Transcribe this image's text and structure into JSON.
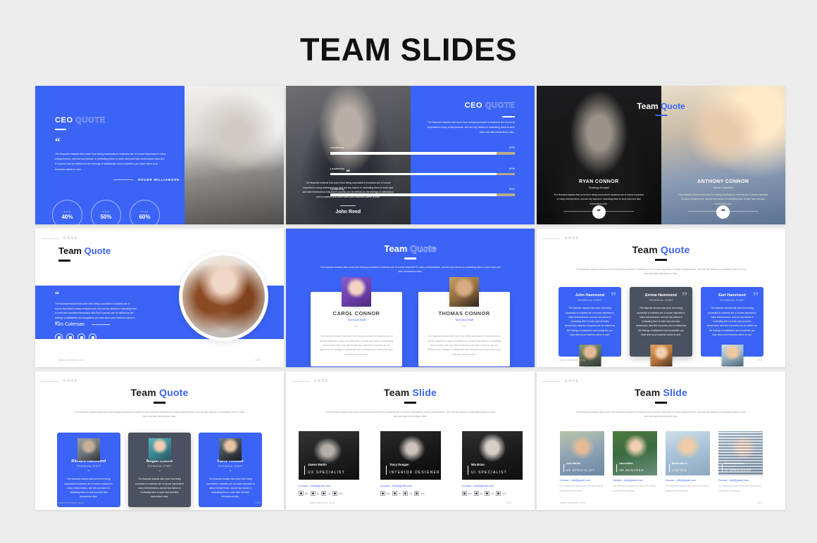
{
  "page": {
    "title": "TEAM SLIDES",
    "accent": "#3b63f6",
    "background": "#ececec"
  },
  "common": {
    "eyebrow": "EASE",
    "website": "www.website.com",
    "quote_glyph": "“",
    "quote_glyph_close": "”",
    "long_quote": "The financial rewards that come from being successful in business are of course important to many entrepreneurs, and are key factors in motivating them to work hard and take tremendous risks.But if success can be defined as the feelings of satisfaction and completion you have when your business career is over.",
    "short_quote": "The financial rewards that come from being successful in business are of course important to many entrepreneurs, and are key factors in motivating them to work hard and take tremendous risks.",
    "sub_line": "The financial rewards that come from being successful in business are of course important to many entrepreneurs, and are key factors in motivating them to work hard and take tremendous risks.",
    "contact": "Contact : info@gmail.com"
  },
  "slides": [
    {
      "id": "ceo-quote-left",
      "heading_solid": "CEO",
      "heading_ghost": "QUOTE",
      "author": "ROGER WILLIAMSON",
      "stats": [
        {
          "label": "TITLE",
          "value": "40%"
        },
        {
          "label": "TITLE",
          "value": "50%"
        },
        {
          "label": "TITLE",
          "value": "60%"
        }
      ]
    },
    {
      "id": "ceo-quote-right",
      "heading_solid": "CEO",
      "heading_ghost": "QUOTE",
      "name": "John Reed",
      "bars": [
        {
          "label": "Leadership",
          "value": "90%",
          "pct": 90
        },
        {
          "label": "Leadership",
          "value": "90%",
          "pct": 90
        },
        {
          "label": "Leadership",
          "value": "90%",
          "pct": 90
        }
      ]
    },
    {
      "id": "team-quote-duo",
      "title_a": "Team",
      "title_b": "Quote",
      "people": [
        {
          "name": "RYAN CONNOR",
          "role": "Strategy Analyst"
        },
        {
          "name": "ANTHONY CONNOR",
          "role": "Senior Statistics"
        }
      ]
    },
    {
      "id": "team-quote-portrait",
      "title_a": "Team",
      "title_b": "Quote",
      "name": "Kim Coleman",
      "socials": [
        "instagram-icon",
        "facebook-icon",
        "twitter-icon",
        "linkedin-icon"
      ],
      "page_number": "185"
    },
    {
      "id": "team-quote-cards-blue",
      "title_a": "Team",
      "title_b": "Quote",
      "cards": [
        {
          "name": "CAROL CONNOR",
          "role": "Technical Staff"
        },
        {
          "name": "THOMAS CONNOR",
          "role": "Technical Staff"
        }
      ]
    },
    {
      "id": "team-quote-three-cards",
      "title_a": "Team",
      "title_b": "Quote",
      "page_number": "199",
      "cards": [
        {
          "name": "John Hammond",
          "role": "TECHNICAL STAFF",
          "theme": "blue"
        },
        {
          "name": "Emma Hammond",
          "role": "TECHNICAL STAFF",
          "theme": "dark"
        },
        {
          "name": "Earl Hammond",
          "role": "TECHNICAL STAFF",
          "theme": "blue"
        }
      ]
    },
    {
      "id": "team-quote-avatar-cards",
      "title_a": "Team",
      "title_b": "Quote",
      "page_number": "190",
      "cards": [
        {
          "name": "Richard Hammond",
          "role": "TECHNICAL STAFF",
          "theme": "blue"
        },
        {
          "name": "Megan Collins",
          "role": "TECHNICAL STAFF",
          "theme": "dark"
        },
        {
          "name": "Harry Thomas",
          "role": "TECHNICAL STAFF",
          "theme": "blue"
        }
      ]
    },
    {
      "id": "team-slide-bw",
      "title_a": "Team",
      "title_b": "Slide",
      "page_number": "199",
      "cards": [
        {
          "name": "James Martin",
          "role": "UX SPECIALIST",
          "chips": [
            {
              "icon": "instagram-icon",
              "count": "50k"
            },
            {
              "icon": "twitter-icon",
              "count": "5k"
            },
            {
              "icon": "youtube-icon",
              "count": "1M"
            },
            {
              "icon": "facebook-icon",
              "count": "50k"
            }
          ]
        },
        {
          "name": "Tracy Dougan",
          "role": "INTERIOR DESIGNER",
          "chips": [
            {
              "icon": "instagram-icon",
              "count": "50k"
            },
            {
              "icon": "twitter-icon",
              "count": "5k"
            },
            {
              "icon": "youtube-icon",
              "count": "1M"
            },
            {
              "icon": "facebook-icon",
              "count": "50k"
            }
          ]
        },
        {
          "name": "Mia Brian",
          "role": "UI SPECIALIST",
          "chips": [
            {
              "icon": "instagram-icon",
              "count": "50k"
            },
            {
              "icon": "twitter-icon",
              "count": "5k"
            },
            {
              "icon": "youtube-icon",
              "count": "1M"
            },
            {
              "icon": "facebook-icon",
              "count": "50k"
            }
          ]
        }
      ]
    },
    {
      "id": "team-slide-color",
      "title_a": "Team",
      "title_b": "Slide",
      "page_number": "230",
      "blurb": "The financial rewards that come from being successful in business.",
      "cards": [
        {
          "name": "John Martin",
          "role": "UX SPECIALIST"
        },
        {
          "name": "Laura Miller",
          "role": "HR MANAGER"
        },
        {
          "name": "Daniel Burch",
          "role": "LAWYER"
        },
        {
          "name": "Samantha Davis",
          "role": "UI SPECIALIST"
        }
      ]
    }
  ]
}
